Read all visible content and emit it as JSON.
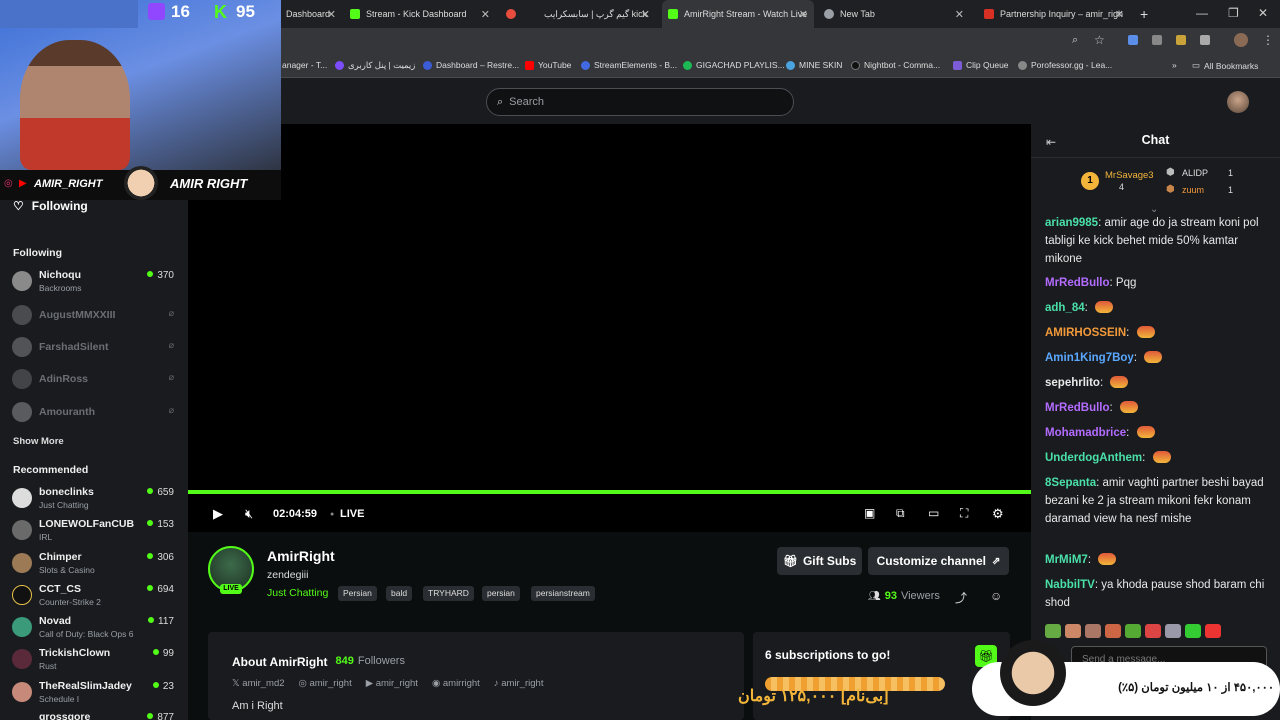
{
  "browser": {
    "tabs": [
      {
        "label": "Dashboard",
        "active": false
      },
      {
        "label": "Stream - Kick Dashboard",
        "active": false
      },
      {
        "label": "",
        "active": false
      },
      {
        "label": "گیم گرپ | سابسکرایب kick",
        "active": false
      },
      {
        "label": "AmirRight Stream - Watch Live",
        "active": true
      },
      {
        "label": "New Tab",
        "active": false
      },
      {
        "label": "Partnership Inquiry – amir_righ",
        "active": false
      }
    ],
    "bookmarks": [
      "anager - T...",
      "زیمیت | پنل کاربری",
      "Dashboard – Restre...",
      "YouTube",
      "StreamElements - B...",
      "GIGACHAD PLAYLIS...",
      "MINE SKIN",
      "Nightbot - Comma...",
      "Clip Queue",
      "Porofessor.gg - Lea..."
    ],
    "all_bookmarks": "All Bookmarks"
  },
  "overlay": {
    "twitch_viewers": "16",
    "kick_viewers": "95",
    "handle": "AMIR_RIGHT",
    "brand": "AMIR RIGHT",
    "goal_text": "۴۵۰,۰۰۰ از ۱۰ میلیون تومان (۵٪)",
    "donation_text": "[بی‌نام] ۱۲۵,۰۰۰ تومان"
  },
  "header": {
    "search_placeholder": "Search"
  },
  "sidebar": {
    "following_title": "Following",
    "following_heading": "Following",
    "following": [
      {
        "name": "Nichoqu",
        "category": "Backrooms",
        "viewers": "370",
        "live": true
      },
      {
        "name": "AugustMMXXIII",
        "category": "",
        "viewers": "",
        "live": false
      },
      {
        "name": "FarshadSilent",
        "category": "",
        "viewers": "",
        "live": false
      },
      {
        "name": "AdinRoss",
        "category": "",
        "viewers": "",
        "live": false
      },
      {
        "name": "Amouranth",
        "category": "",
        "viewers": "",
        "live": false
      }
    ],
    "show_more": "Show More",
    "recommended_heading": "Recommended",
    "recommended": [
      {
        "name": "boneclinks",
        "category": "Just Chatting",
        "viewers": "659"
      },
      {
        "name": "LONEWOLFanCUB",
        "category": "IRL",
        "viewers": "153"
      },
      {
        "name": "Chimper",
        "category": "Slots & Casino",
        "viewers": "306"
      },
      {
        "name": "CCT_CS",
        "category": "Counter-Strike 2",
        "viewers": "694"
      },
      {
        "name": "Novad",
        "category": "Call of Duty: Black Ops 6",
        "viewers": "117"
      },
      {
        "name": "TrickishClown",
        "category": "Rust",
        "viewers": "99"
      },
      {
        "name": "TheRealSlimJadey",
        "category": "Schedule I",
        "viewers": "23"
      },
      {
        "name": "grossgore",
        "category": "",
        "viewers": "877"
      }
    ]
  },
  "player": {
    "time": "02:04:59",
    "live_label": "LIVE"
  },
  "channel": {
    "name": "AmirRight",
    "title": "zendegiii",
    "category": "Just Chatting",
    "tags": [
      "Persian",
      "bald",
      "TRYHARD",
      "persian",
      "persianstream"
    ],
    "live_badge": "LIVE",
    "gift_subs": "Gift Subs",
    "customize": "Customize channel",
    "viewers": "93",
    "viewers_label": "Viewers",
    "about_title": "About AmirRight",
    "followers": "849",
    "followers_label": "Followers",
    "socials": [
      "amir_md2",
      "amir_right",
      "amir_right",
      "amirright",
      "amir_right"
    ],
    "bio": "Am i Right",
    "sub_goal": "6 subscriptions to go!"
  },
  "chat": {
    "title": "Chat",
    "leaderboard": [
      {
        "rank": "1",
        "name": "MrSavage3",
        "count": "4"
      },
      {
        "name": "ALIDP",
        "count": "1"
      },
      {
        "name": "zuum",
        "count": "1"
      }
    ],
    "messages": [
      {
        "user": "arian9985",
        "color": "#4ae0a8",
        "text": "amir age do ja stream koni pol tabligi ke kick behet mide 50% kamtar mikone",
        "emote": false
      },
      {
        "user": "MrRedBullo",
        "color": "#b36cff",
        "text": "Pqg",
        "emote": false
      },
      {
        "user": "adh_84",
        "color": "#4ae0a8",
        "text": "",
        "emote": true
      },
      {
        "user": "AMIRHOSSEIN",
        "color": "#f2993a",
        "text": "",
        "emote": true
      },
      {
        "user": "Amin1King7Boy",
        "color": "#5aa8ff",
        "text": "",
        "emote": true
      },
      {
        "user": "sepehrlito",
        "color": "#e8e8e8",
        "text": "",
        "emote": true
      },
      {
        "user": "MrRedBullo",
        "color": "#b36cff",
        "text": "",
        "emote": true
      },
      {
        "user": "Mohamadbrice",
        "color": "#b36cff",
        "text": "",
        "emote": true
      },
      {
        "user": "UnderdogAnthem",
        "color": "#4ae0a8",
        "text": "",
        "emote": true
      },
      {
        "user": "8Sepanta",
        "color": "#4ae0a8",
        "text": "amir vaghti partner beshi bayad bezani ke 2 ja stream mikoni fekr konam daramad view ha nesf mishe",
        "emote": false
      },
      {
        "user": "MrMiM7",
        "color": "#4ae0a8",
        "text": "",
        "emote": true
      },
      {
        "user": "NabbilTV",
        "color": "#4ae0a8",
        "text": "ya khoda pause shod baram chi shod",
        "emote": false
      }
    ],
    "input_placeholder": "Send a message..."
  },
  "colors": {
    "accent": "#53fc18",
    "bg": "#0b0e0f",
    "panel": "#191b1f"
  }
}
